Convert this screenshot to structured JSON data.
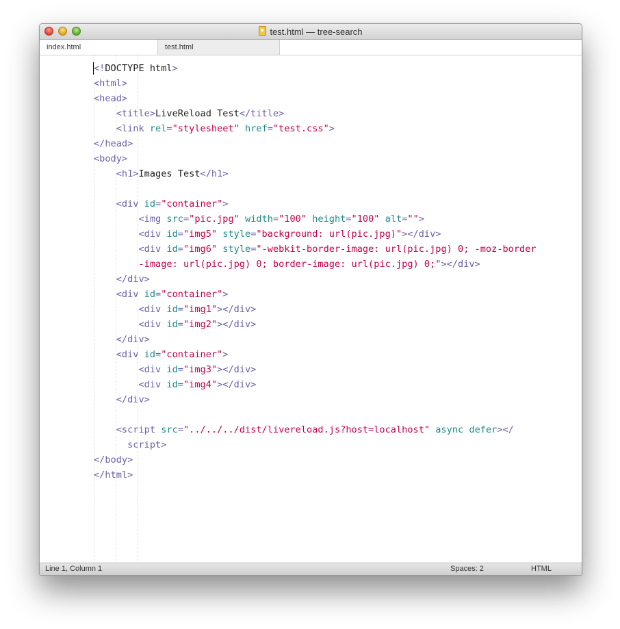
{
  "window": {
    "title": "test.html — tree-search"
  },
  "tabs": [
    {
      "label": "index.html",
      "active": true
    },
    {
      "label": "test.html",
      "active": false
    }
  ],
  "code": {
    "lines": [
      [
        [
          "tg",
          "<!"
        ],
        [
          "tx",
          "DOCTYPE html"
        ],
        [
          "tg",
          ">"
        ]
      ],
      [
        [
          "tg",
          "<html>"
        ]
      ],
      [
        [
          "tg",
          "<head>"
        ]
      ],
      [
        [
          "sp",
          "    "
        ],
        [
          "tg",
          "<title>"
        ],
        [
          "tx",
          "LiveReload Test"
        ],
        [
          "tg",
          "</title>"
        ]
      ],
      [
        [
          "sp",
          "    "
        ],
        [
          "tg",
          "<link "
        ],
        [
          "at",
          "rel"
        ],
        [
          "tg",
          "="
        ],
        [
          "st",
          "\"stylesheet\""
        ],
        [
          "tx",
          " "
        ],
        [
          "at",
          "href"
        ],
        [
          "tg",
          "="
        ],
        [
          "st",
          "\"test.css\""
        ],
        [
          "tg",
          ">"
        ]
      ],
      [
        [
          "tg",
          "</head>"
        ]
      ],
      [
        [
          "tg",
          "<body>"
        ]
      ],
      [
        [
          "sp",
          "    "
        ],
        [
          "tg",
          "<h1>"
        ],
        [
          "tx",
          "Images Test"
        ],
        [
          "tg",
          "</h1>"
        ]
      ],
      [],
      [
        [
          "sp",
          "    "
        ],
        [
          "tg",
          "<div "
        ],
        [
          "at",
          "id"
        ],
        [
          "tg",
          "="
        ],
        [
          "st",
          "\"container\""
        ],
        [
          "tg",
          ">"
        ]
      ],
      [
        [
          "sp",
          "        "
        ],
        [
          "tg",
          "<img "
        ],
        [
          "at",
          "src"
        ],
        [
          "tg",
          "="
        ],
        [
          "st",
          "\"pic.jpg\""
        ],
        [
          "tx",
          " "
        ],
        [
          "at",
          "width"
        ],
        [
          "tg",
          "="
        ],
        [
          "st",
          "\"100\""
        ],
        [
          "tx",
          " "
        ],
        [
          "at",
          "height"
        ],
        [
          "tg",
          "="
        ],
        [
          "st",
          "\"100\""
        ],
        [
          "tx",
          " "
        ],
        [
          "at",
          "alt"
        ],
        [
          "tg",
          "="
        ],
        [
          "st",
          "\"\""
        ],
        [
          "tg",
          ">"
        ]
      ],
      [
        [
          "sp",
          "        "
        ],
        [
          "tg",
          "<div "
        ],
        [
          "at",
          "id"
        ],
        [
          "tg",
          "="
        ],
        [
          "st",
          "\"img5\""
        ],
        [
          "tx",
          " "
        ],
        [
          "at",
          "style"
        ],
        [
          "tg",
          "="
        ],
        [
          "st",
          "\"background: url(pic.jpg)\""
        ],
        [
          "tg",
          "></div>"
        ]
      ],
      [
        [
          "sp",
          "        "
        ],
        [
          "tg",
          "<div "
        ],
        [
          "at",
          "id"
        ],
        [
          "tg",
          "="
        ],
        [
          "st",
          "\"img6\""
        ],
        [
          "tx",
          " "
        ],
        [
          "at",
          "style"
        ],
        [
          "tg",
          "="
        ],
        [
          "st",
          "\"-webkit-border-image: url(pic.jpg) 0; -moz-border"
        ]
      ],
      [
        [
          "sp",
          "        "
        ],
        [
          "st",
          "-image: url(pic.jpg) 0; border-image: url(pic.jpg) 0;\""
        ],
        [
          "tg",
          "></div>"
        ]
      ],
      [
        [
          "sp",
          "    "
        ],
        [
          "tg",
          "</div>"
        ]
      ],
      [
        [
          "sp",
          "    "
        ],
        [
          "tg",
          "<div "
        ],
        [
          "at",
          "id"
        ],
        [
          "tg",
          "="
        ],
        [
          "st",
          "\"container\""
        ],
        [
          "tg",
          ">"
        ]
      ],
      [
        [
          "sp",
          "        "
        ],
        [
          "tg",
          "<div "
        ],
        [
          "at",
          "id"
        ],
        [
          "tg",
          "="
        ],
        [
          "st",
          "\"img1\""
        ],
        [
          "tg",
          "></div>"
        ]
      ],
      [
        [
          "sp",
          "        "
        ],
        [
          "tg",
          "<div "
        ],
        [
          "at",
          "id"
        ],
        [
          "tg",
          "="
        ],
        [
          "st",
          "\"img2\""
        ],
        [
          "tg",
          "></div>"
        ]
      ],
      [
        [
          "sp",
          "    "
        ],
        [
          "tg",
          "</div>"
        ]
      ],
      [
        [
          "sp",
          "    "
        ],
        [
          "tg",
          "<div "
        ],
        [
          "at",
          "id"
        ],
        [
          "tg",
          "="
        ],
        [
          "st",
          "\"container\""
        ],
        [
          "tg",
          ">"
        ]
      ],
      [
        [
          "sp",
          "        "
        ],
        [
          "tg",
          "<div "
        ],
        [
          "at",
          "id"
        ],
        [
          "tg",
          "="
        ],
        [
          "st",
          "\"img3\""
        ],
        [
          "tg",
          "></div>"
        ]
      ],
      [
        [
          "sp",
          "        "
        ],
        [
          "tg",
          "<div "
        ],
        [
          "at",
          "id"
        ],
        [
          "tg",
          "="
        ],
        [
          "st",
          "\"img4\""
        ],
        [
          "tg",
          "></div>"
        ]
      ],
      [
        [
          "sp",
          "    "
        ],
        [
          "tg",
          "</div>"
        ]
      ],
      [],
      [
        [
          "sp",
          "    "
        ],
        [
          "tg",
          "<script "
        ],
        [
          "at",
          "src"
        ],
        [
          "tg",
          "="
        ],
        [
          "st",
          "\"../../../dist/livereload.js?host=localhost\""
        ],
        [
          "tx",
          " "
        ],
        [
          "at",
          "async defer"
        ],
        [
          "tg",
          "></"
        ]
      ],
      [
        [
          "sp",
          "      "
        ],
        [
          "tg",
          "script>"
        ]
      ],
      [
        [
          "tg",
          "</body>"
        ]
      ],
      [
        [
          "tg",
          "</html>"
        ]
      ]
    ]
  },
  "statusbar": {
    "position": "Line 1, Column 1",
    "indentation": "Spaces: 2",
    "syntax": "HTML"
  }
}
